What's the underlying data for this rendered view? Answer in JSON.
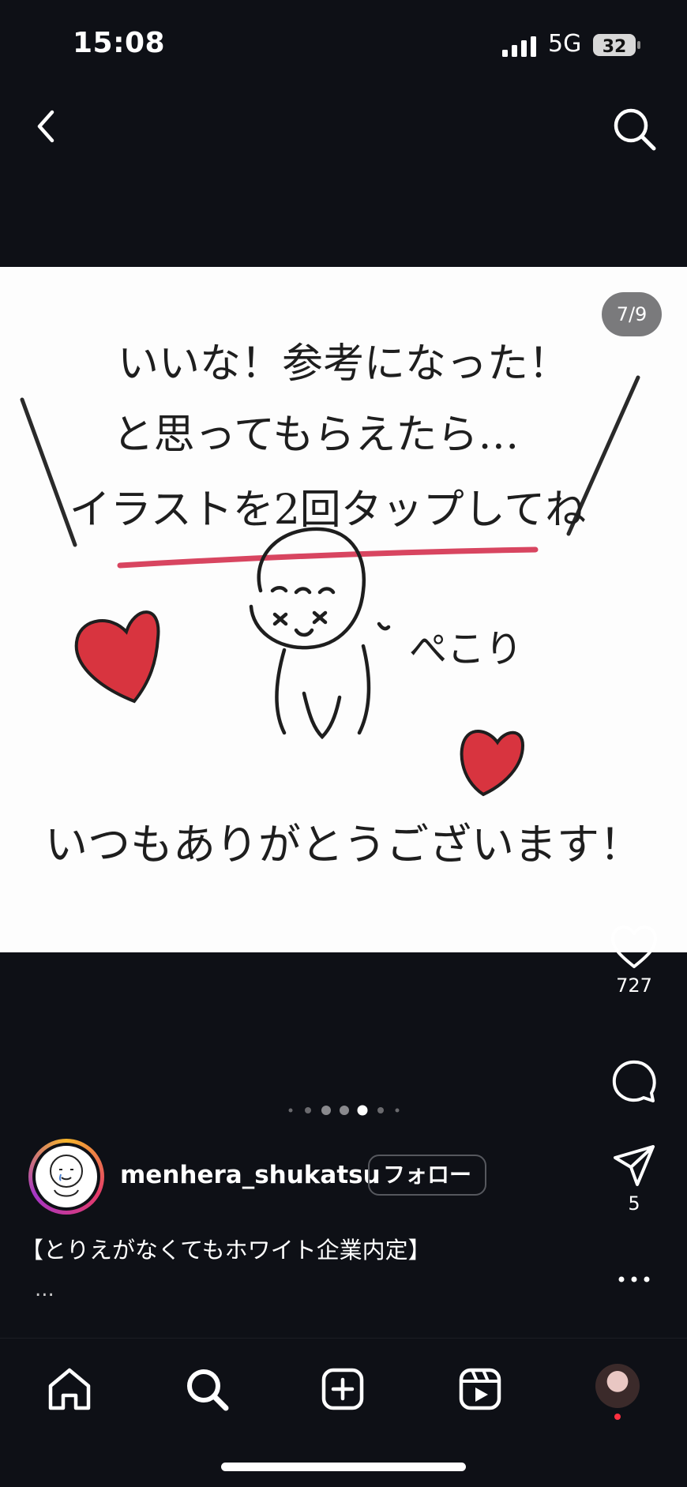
{
  "status": {
    "time": "15:08",
    "network": "5G",
    "battery": "32"
  },
  "post": {
    "counter": "7/9",
    "slide_current": 7,
    "slide_total": 9,
    "image_text": {
      "line1": "いいな！参考になった！",
      "line2": "と思ってもらえたら…",
      "line3": "イラストを2回タップしてね",
      "bow": "ぺこり",
      "thanks": "いつもありがとうございます！"
    }
  },
  "actions": {
    "likes": "727",
    "shares": "5"
  },
  "author": {
    "username": "menhera_shukatsu",
    "follow_label": "フォロー"
  },
  "caption": {
    "text": "【とりえがなくてもホワイト企業内定】",
    "more": "..."
  },
  "icons": {
    "back": "back-arrow-icon",
    "search": "search-icon",
    "like": "heart-icon",
    "comment": "comment-icon",
    "share": "send-icon",
    "more": "more-icon",
    "home": "home-icon",
    "explore": "search-icon",
    "create": "plus-square-icon",
    "reels": "reels-icon",
    "profile": "profile-avatar"
  },
  "colors": {
    "background": "#0e1016",
    "underline": "#d84560",
    "heart": "#d8343f",
    "notification": "#ff3040"
  }
}
